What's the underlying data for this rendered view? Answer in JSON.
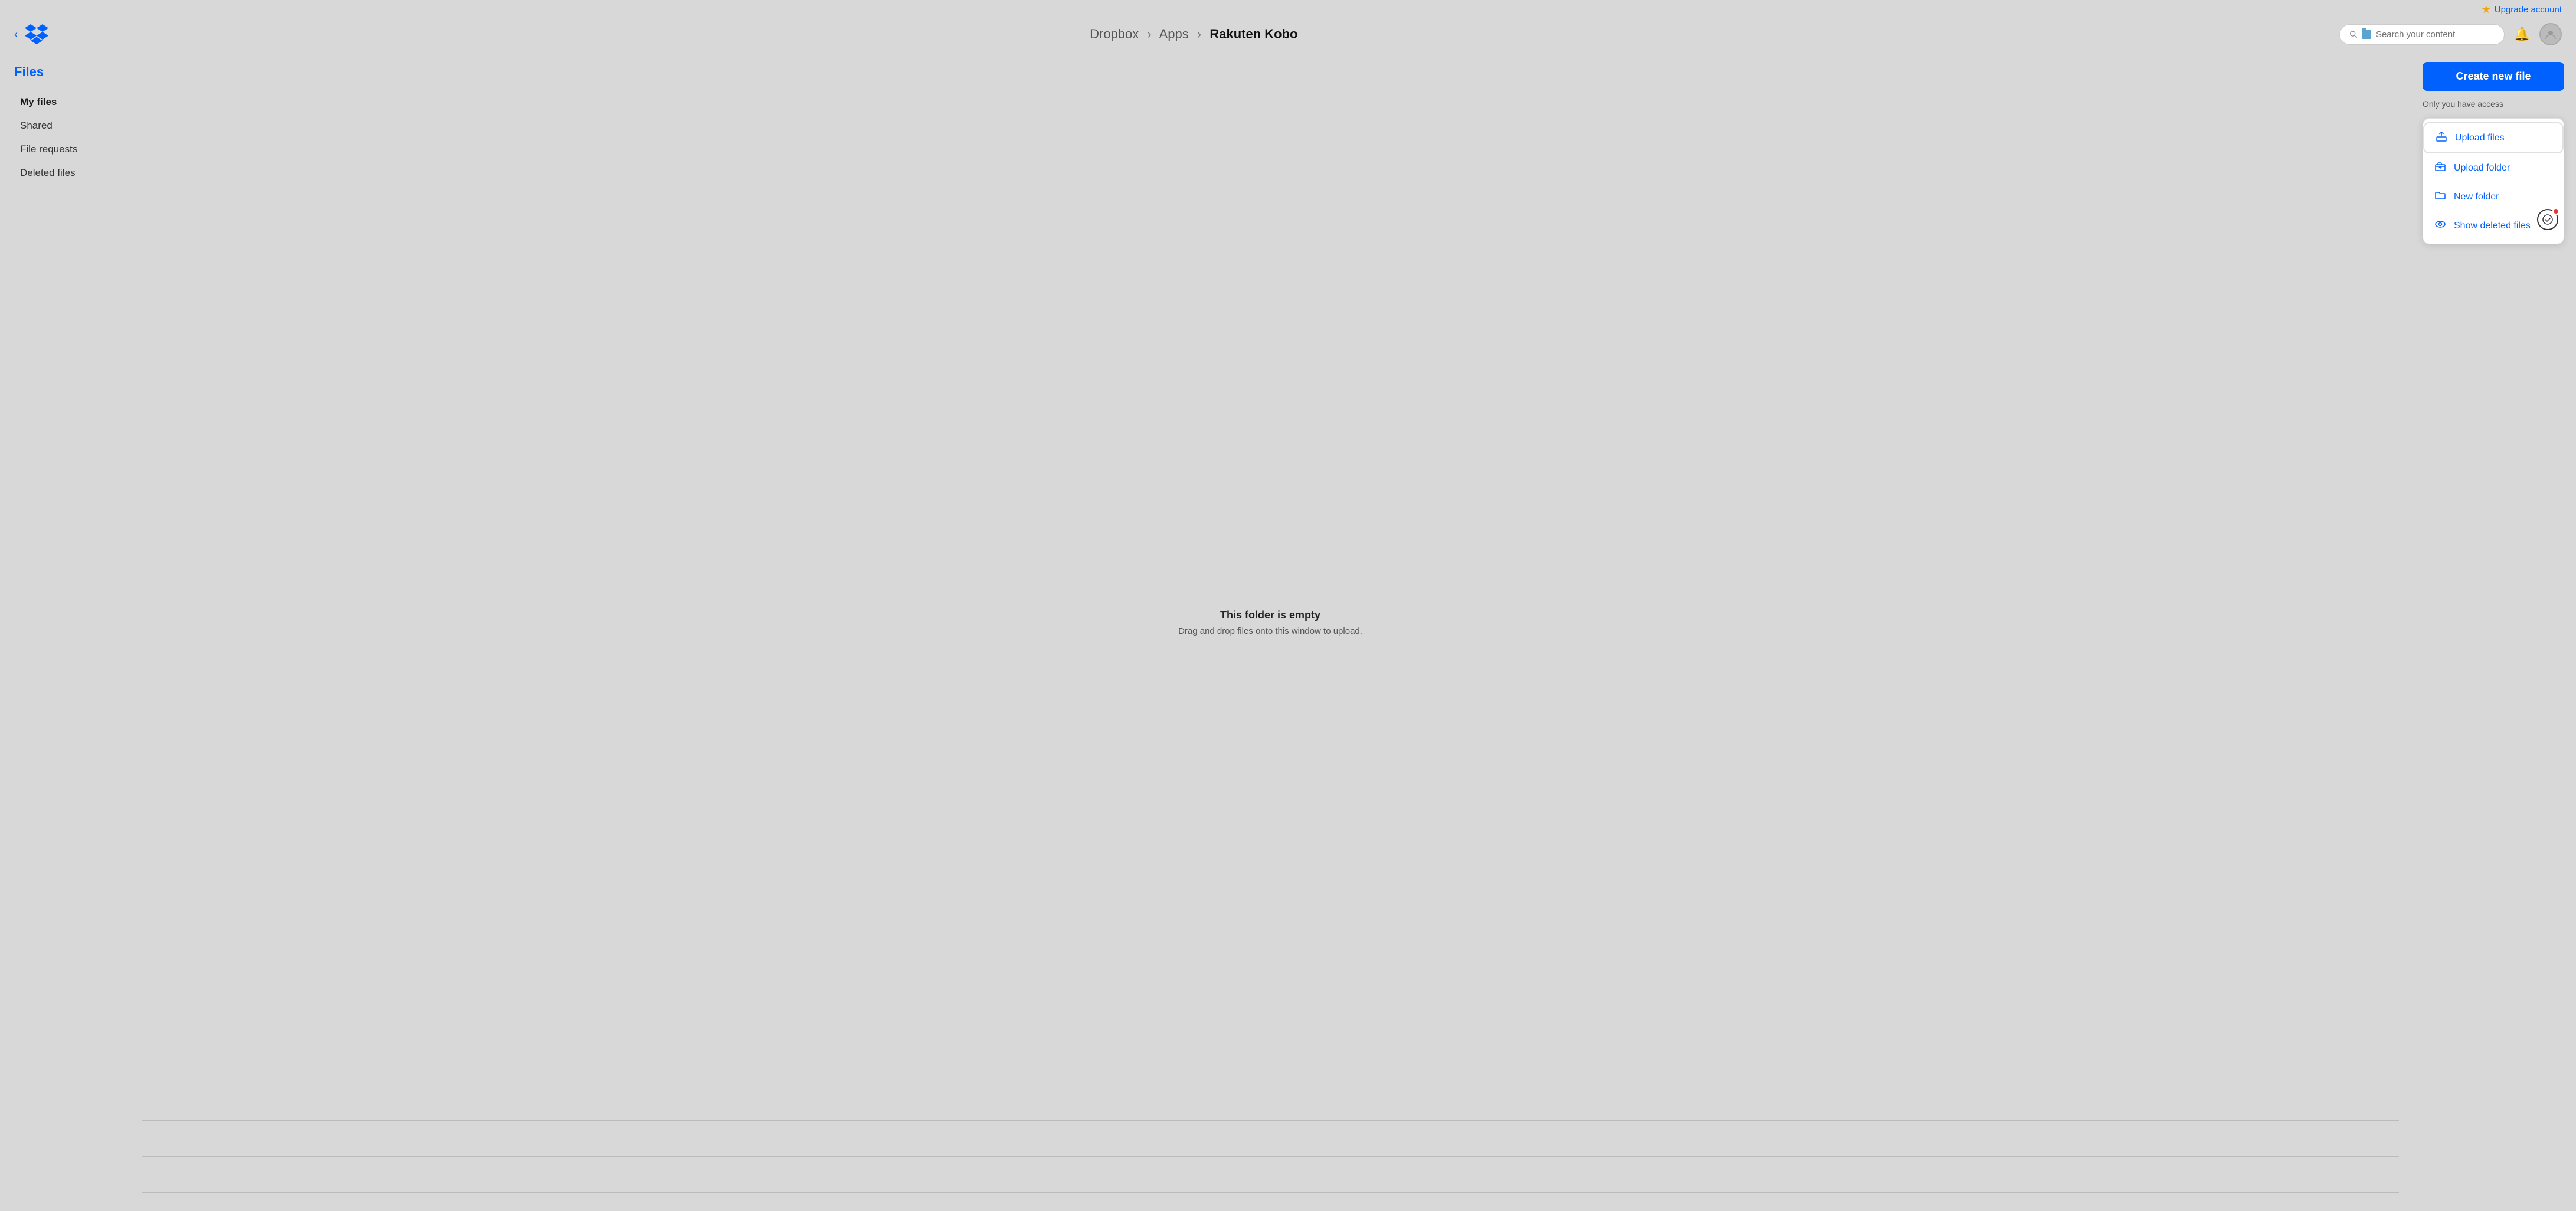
{
  "header": {
    "back_label": "‹",
    "breadcrumb": {
      "part1": "Dropbox",
      "sep1": "›",
      "part2": "Apps",
      "sep2": "›",
      "part3": "Rakuten Kobo"
    },
    "search_placeholder": "Search your content",
    "upgrade_label": "Upgrade account"
  },
  "sidebar": {
    "title": "Files",
    "items": [
      {
        "id": "my-files",
        "label": "My files",
        "active": true
      },
      {
        "id": "shared",
        "label": "Shared",
        "active": false
      },
      {
        "id": "file-requests",
        "label": "File requests",
        "active": false
      },
      {
        "id": "deleted-files",
        "label": "Deleted files",
        "active": false
      }
    ]
  },
  "main": {
    "empty_title": "This folder is empty",
    "empty_subtitle": "Drag and drop files onto this window to upload."
  },
  "right_panel": {
    "create_button": "Create new file",
    "access_text": "Only you have access",
    "dropdown": {
      "items": [
        {
          "id": "upload-files",
          "label": "Upload files",
          "icon": "upload"
        },
        {
          "id": "upload-folder",
          "label": "Upload folder",
          "icon": "upload-folder"
        },
        {
          "id": "new-folder",
          "label": "New folder",
          "icon": "folder"
        },
        {
          "id": "show-deleted",
          "label": "Show deleted files",
          "icon": "eye"
        }
      ]
    }
  },
  "colors": {
    "blue": "#0061fe",
    "accent_gold": "#f0a500",
    "bg": "#d8d8d8",
    "white": "#ffffff"
  }
}
